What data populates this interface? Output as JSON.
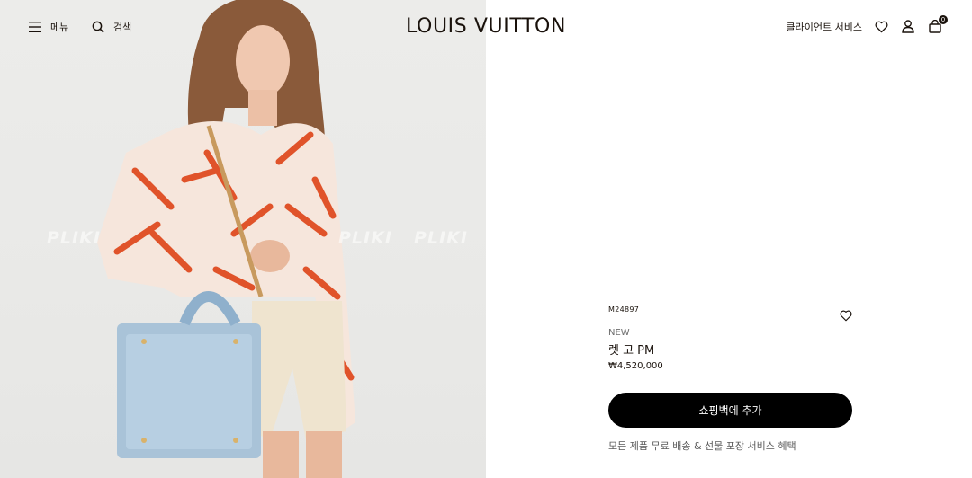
{
  "header": {
    "menu_label": "메뉴",
    "search_label": "검색",
    "logo": "LOUIS VUITTON",
    "client_service_label": "클라이언트 서비스",
    "bag_count": "0"
  },
  "media": {
    "watermark": "PLIKI"
  },
  "product": {
    "sku": "M24897",
    "tag": "NEW",
    "name": "렛 고 PM",
    "price": "₩4,520,000",
    "add_to_bag_label": "쇼핑백에 추가",
    "benefit_text": "모든 제품 무료 배송 & 선물 포장 서비스 혜택"
  },
  "colors": {
    "brand_text": "#19110b",
    "button_bg": "#000000",
    "button_text": "#ffffff",
    "image_bg": "#eaeae8"
  }
}
